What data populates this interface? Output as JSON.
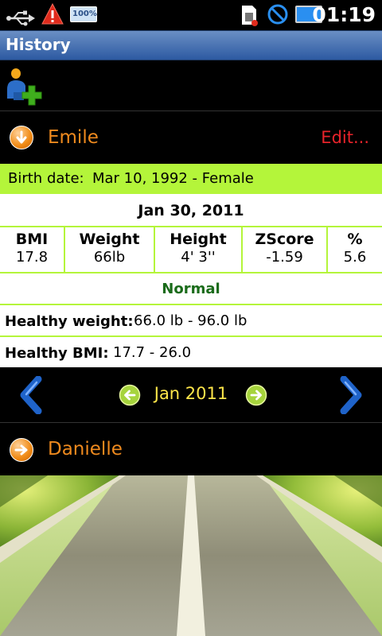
{
  "status_bar": {
    "clock": "01:19",
    "battery_badge": "100%",
    "icons": [
      "usb-icon",
      "warning-icon",
      "battery-badge-icon",
      "sim-icon",
      "no-signal-icon",
      "battery-icon"
    ]
  },
  "app": {
    "title": "History"
  },
  "toolbar": {
    "add_user_icon": "add-user-icon"
  },
  "profiles": [
    {
      "name": "Emile",
      "expanded": true,
      "edit_label": "Edit..."
    },
    {
      "name": "Danielle",
      "expanded": false
    }
  ],
  "details": {
    "birth_label": "Birth date:",
    "birth_value": "Mar 10, 1992 - Female",
    "entry_date": "Jan 30, 2011",
    "columns": [
      {
        "header": "BMI",
        "value": "17.8"
      },
      {
        "header": "Weight",
        "value": "66lb"
      },
      {
        "header": "Height",
        "value": "4' 3''"
      },
      {
        "header": "ZScore",
        "value": "-1.59"
      },
      {
        "header": "%",
        "value": "5.6"
      }
    ],
    "status": "Normal",
    "healthy_weight_label": "Healthy weight:",
    "healthy_weight_value": "66.0 lb - 96.0 lb",
    "healthy_bmi_label": "Healthy BMI:",
    "healthy_bmi_value": "17.7 - 26.0"
  },
  "navigation": {
    "month": "Jan 2011"
  },
  "colors": {
    "accent_orange": "#ef8a1e",
    "edit_red": "#e8232a",
    "highlight_green": "#b4f53a",
    "status_green": "#1a6b1a",
    "month_yellow": "#ffe64a",
    "titlebar_blue": "#2d5aa2"
  }
}
